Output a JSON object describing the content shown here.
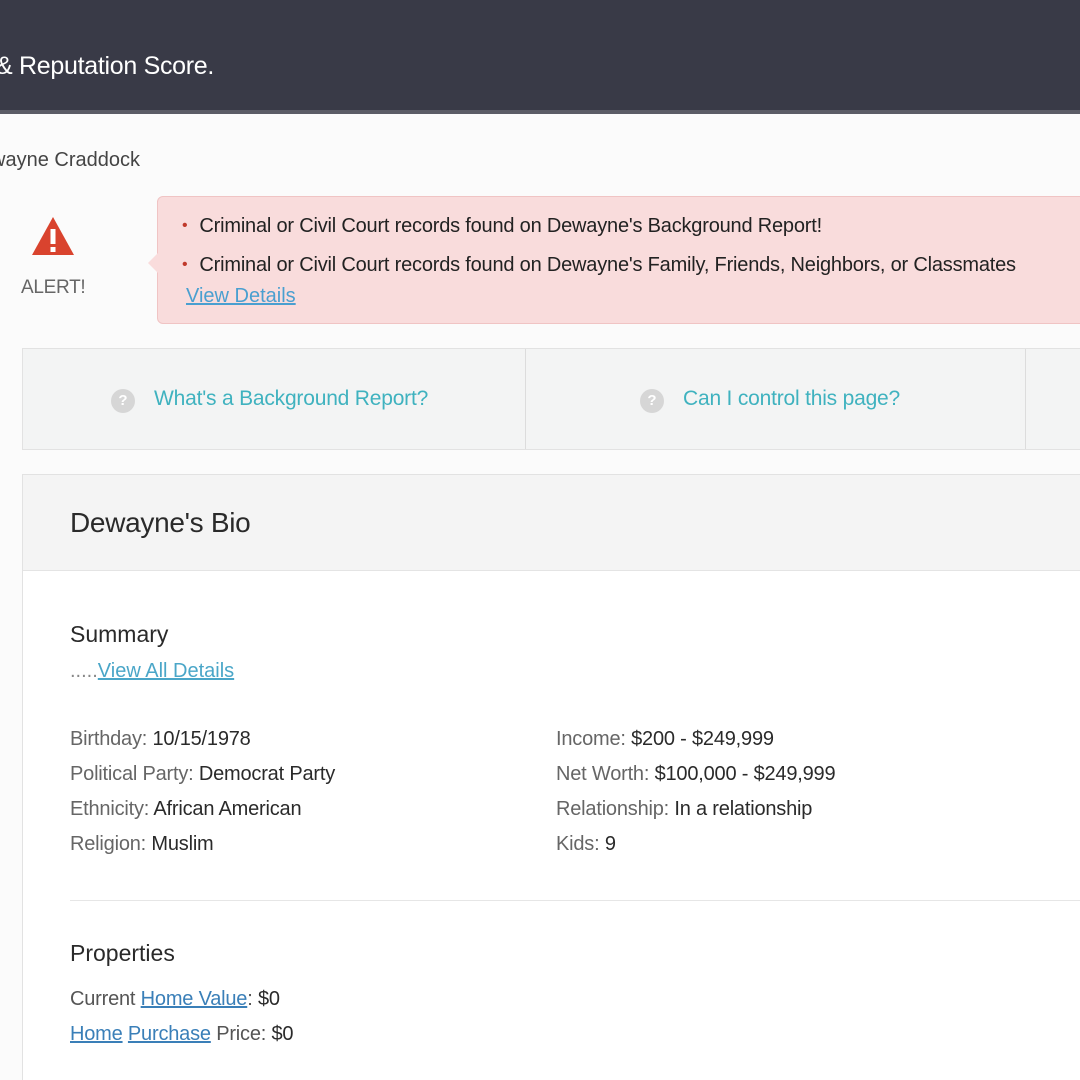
{
  "header": {
    "title": "& Reputation Score."
  },
  "breadcrumb": "wayne Craddock",
  "alert": {
    "label": "ALERT!",
    "items": [
      "Criminal or Civil Court records found on Dewayne's Background Report!",
      "Criminal or Civil Court records found on Dewayne's Family, Friends, Neighbors, or Classmates"
    ],
    "link": "View Details"
  },
  "info_tabs": [
    {
      "icon": "question-icon",
      "label": "What's a Background Report?"
    },
    {
      "icon": "question-icon",
      "label": "Can I control this page?"
    }
  ],
  "bio": {
    "title": "Dewayne's Bio",
    "summary": {
      "heading": "Summary",
      "dots": ".....",
      "link": "View All Details",
      "left": [
        {
          "key": "Birthday:",
          "value": "10/15/1978"
        },
        {
          "key": "Political Party:",
          "value": "Democrat Party"
        },
        {
          "key": "Ethnicity:",
          "value": "African American"
        },
        {
          "key": "Religion:",
          "value": "Muslim"
        }
      ],
      "right": [
        {
          "key": "Income:",
          "value": "$200 - $249,999"
        },
        {
          "key": "Net Worth:",
          "value": "$100,000 - $249,999"
        },
        {
          "key": "Relationship:",
          "value": "In a relationship"
        },
        {
          "key": "Kids:",
          "value": "9"
        }
      ]
    },
    "properties": {
      "heading": "Properties",
      "line1": {
        "prefix": "Current",
        "link": "Home Value",
        "suffix": ":",
        "value": "$0"
      },
      "line2": {
        "link1": "Home",
        "link2": "Purchase",
        "suffix": "Price:",
        "value": "$0"
      }
    }
  },
  "colors": {
    "header_bg": "#393a47",
    "alert_bg": "#f9dcdc",
    "alert_icon": "#d9432e",
    "link": "#4aa6c8",
    "info_link": "#3fb2bf"
  }
}
